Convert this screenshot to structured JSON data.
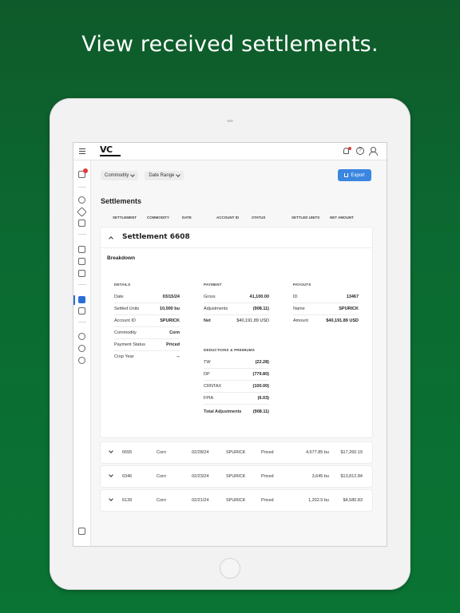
{
  "headline": "View received settlements.",
  "app": {
    "logo_text": "VC"
  },
  "toolbar": {
    "filters": [
      "Commodity",
      "Date Range"
    ],
    "export_label": "Export"
  },
  "page": {
    "title": "Settlements",
    "columns": [
      "SETTLEMENT",
      "COMMODITY",
      "DATE",
      "ACCOUNT ID",
      "STATUS",
      "SETTLED UNITS",
      "NET AMOUNT"
    ]
  },
  "expanded": {
    "title": "Settlement 6608",
    "breakdown_label": "Breakdown",
    "details": {
      "heading": "DETAILS",
      "rows": [
        {
          "k": "Date",
          "v": "03/15/24"
        },
        {
          "k": "Settled Units",
          "v": "10,000 bu"
        },
        {
          "k": "Account ID",
          "v": "SPURICK"
        },
        {
          "k": "Commodity",
          "v": "Corn"
        },
        {
          "k": "Payment Status",
          "v": "Priced"
        },
        {
          "k": "Crop Year",
          "v": "--"
        }
      ]
    },
    "payment": {
      "heading": "PAYMENT",
      "rows": [
        {
          "k": "Gross",
          "v": "41,100.00"
        },
        {
          "k": "Adjustments",
          "v": "(908.11)"
        },
        {
          "k": "Net",
          "v": "$40,191.89 USD"
        }
      ]
    },
    "payouts": {
      "heading": "PAYOUTS",
      "rows": [
        {
          "k": "ID",
          "v": "13467"
        },
        {
          "k": "Name",
          "v": "SPURICK"
        },
        {
          "k": "Amount",
          "v": "$40,191.89 USD"
        }
      ]
    },
    "deductions": {
      "heading": "DEDUCTIONS & PREMIUMS",
      "rows": [
        {
          "k": "TW",
          "v": "(22.28)"
        },
        {
          "k": "DP",
          "v": "(779.80)"
        },
        {
          "k": "CRNTAX",
          "v": "(100.00)"
        },
        {
          "k": "FPIA",
          "v": "(6.03)"
        }
      ],
      "total_label": "Total Adjustments",
      "total_value": "(908.11)"
    }
  },
  "rows": [
    {
      "id": "6555",
      "commodity": "Corn",
      "date": "02/28/24",
      "account": "SPURICK",
      "status": "Priced",
      "units": "4,677.85 bu",
      "amount": "$17,260.19"
    },
    {
      "id": "6346",
      "commodity": "Corn",
      "date": "02/23/24",
      "account": "SPURICK",
      "status": "Priced",
      "units": "3,645 bu",
      "amount": "$13,812.84"
    },
    {
      "id": "6139",
      "commodity": "Corn",
      "date": "02/21/24",
      "account": "SPURICK",
      "status": "Priced",
      "units": "1,202.5 bu",
      "amount": "$4,580.83"
    }
  ]
}
